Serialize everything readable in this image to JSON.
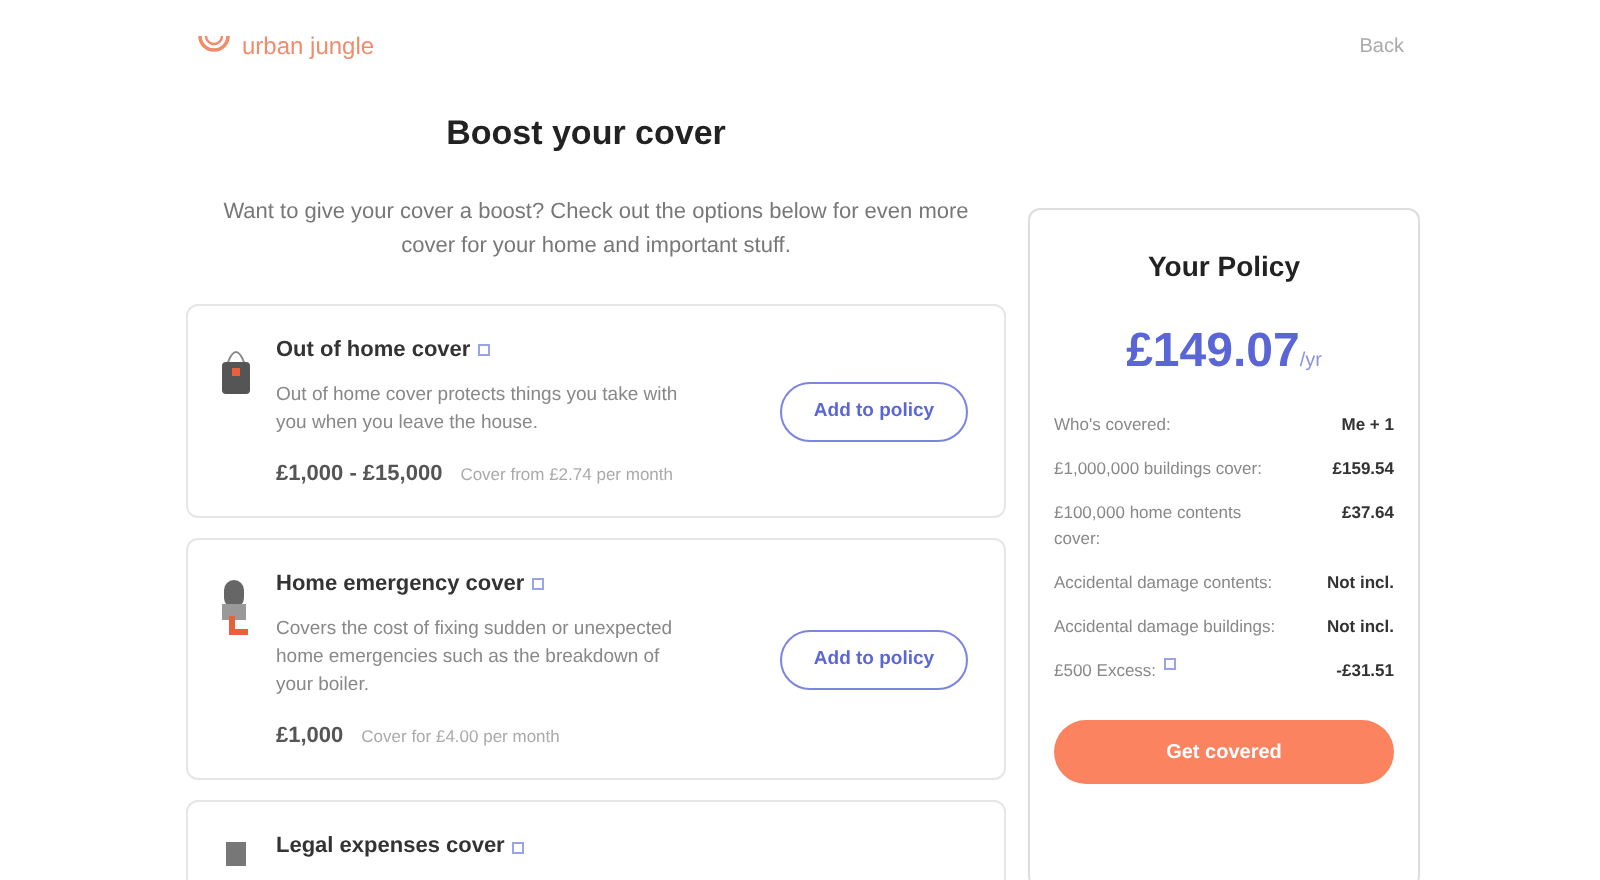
{
  "header": {
    "logo": "urban jungle",
    "back": "Back"
  },
  "title": "Boost your cover",
  "intro": "Want to give your cover a boost? Check out the options below for even more cover for your home and important stuff.",
  "options": [
    {
      "kind": "bag",
      "title": "Out of home cover",
      "description": "Out of home cover protects things you take with you when you leave the house.",
      "amount": "£1,000 - £15,000",
      "price": "Cover from £2.74 per month",
      "button": "Add to policy"
    },
    {
      "kind": "boiler",
      "title": "Home emergency cover",
      "description": "Covers the cost of fixing sudden or unexpected home emergencies such as the breakdown of your boiler.",
      "amount": "£1,000",
      "price": "Cover for £4.00 per month",
      "button": "Add to policy"
    },
    {
      "kind": "legal",
      "title": "Legal expenses cover"
    }
  ],
  "policy": {
    "title": "Your Policy",
    "price": "£149.07",
    "period": "/yr",
    "rows": [
      {
        "label": "Who's covered:",
        "value": "Me + 1",
        "info": false
      },
      {
        "label": "£1,000,000 buildings cover:",
        "value": "£159.54",
        "info": false
      },
      {
        "label": "£100,000 home contents cover:",
        "value": "£37.64",
        "info": false
      },
      {
        "label": "Accidental damage contents:",
        "value": "Not incl.",
        "info": false
      },
      {
        "label": "Accidental damage buildings:",
        "value": "Not incl.",
        "info": false
      },
      {
        "label": "£500 Excess:",
        "value": "-£31.51",
        "info": true
      }
    ],
    "button": "Get covered"
  }
}
